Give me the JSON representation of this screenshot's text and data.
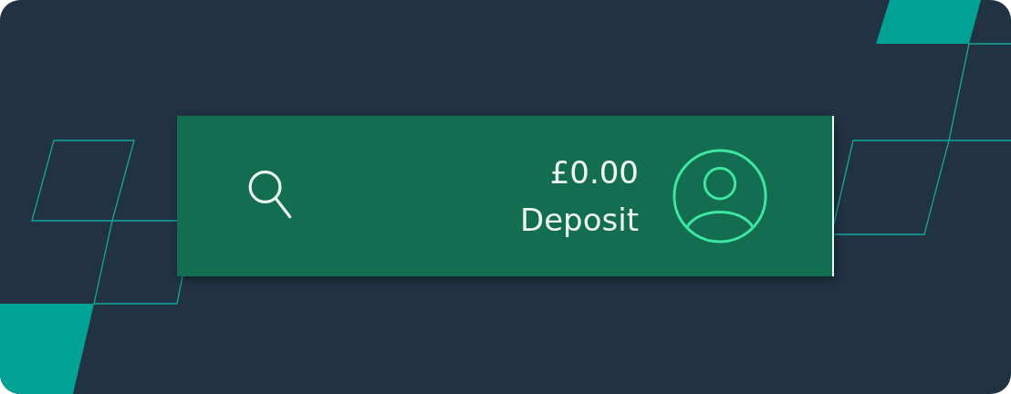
{
  "header": {
    "balance": "£0.00",
    "deposit_label": "Deposit"
  }
}
